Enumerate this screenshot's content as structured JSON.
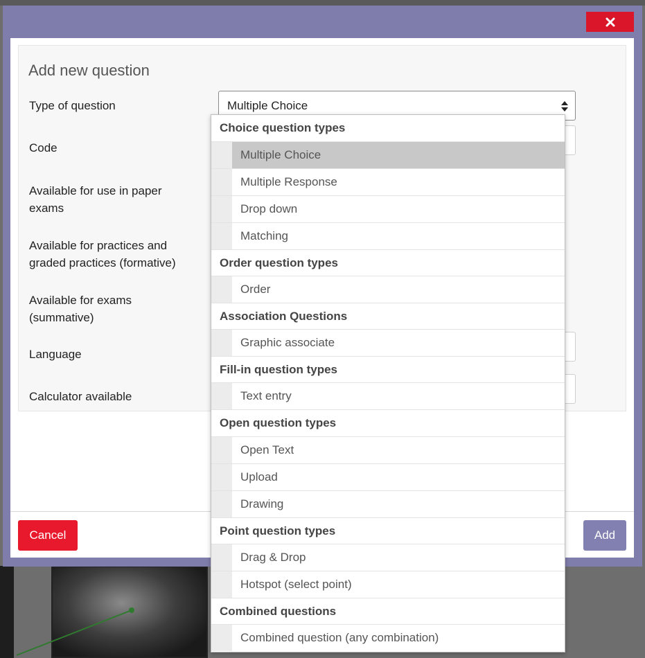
{
  "dialog": {
    "title": "Add new question",
    "close_icon": "close-icon",
    "fields": {
      "type_label": "Type of question",
      "type_value": "Multiple Choice",
      "code_label": "Code",
      "paper_label_1": "Available for use in paper",
      "paper_label_2": "exams",
      "practice_label_1": "Available for practices and",
      "practice_label_2": "graded practices (formative)",
      "exams_label_1": "Available for exams",
      "exams_label_2": "(summative)",
      "language_label": "Language",
      "calculator_label": "Calculator available"
    },
    "buttons": {
      "cancel": "Cancel",
      "add": "Add"
    },
    "colors": {
      "header": "#7f7dab",
      "cancel": "#e8192c",
      "close": "#d9162a",
      "add": "#8280b0"
    }
  },
  "dropdown": {
    "selected": "Multiple Choice",
    "groups": [
      {
        "header": "Choice question types",
        "options": [
          "Multiple Choice",
          "Multiple Response",
          "Drop down",
          "Matching"
        ]
      },
      {
        "header": "Order question types",
        "options": [
          "Order"
        ]
      },
      {
        "header": "Association Questions",
        "options": [
          "Graphic associate"
        ]
      },
      {
        "header": "Fill-in question types",
        "options": [
          "Text entry"
        ]
      },
      {
        "header": "Open question types",
        "options": [
          "Open Text",
          "Upload",
          "Drawing"
        ]
      },
      {
        "header": "Point question types",
        "options": [
          "Drag & Drop",
          "Hotspot (select point)"
        ]
      },
      {
        "header": "Combined questions",
        "options": [
          "Combined question (any combination)"
        ]
      }
    ]
  }
}
